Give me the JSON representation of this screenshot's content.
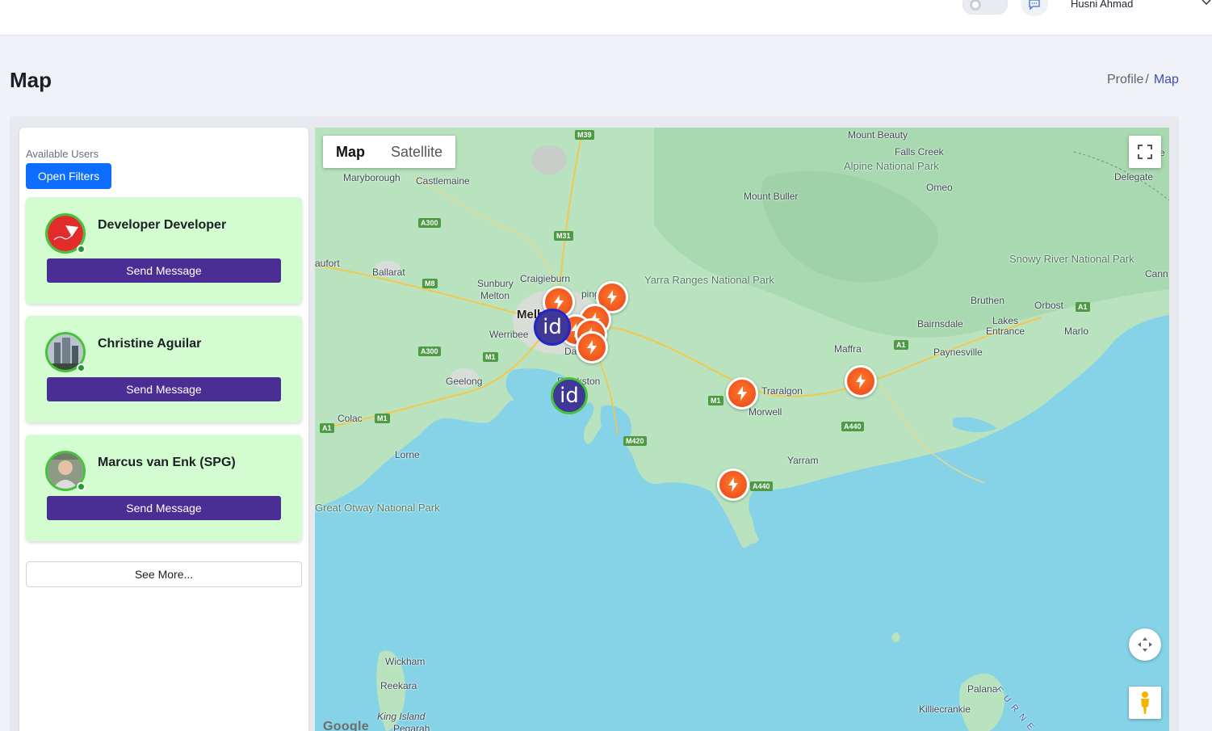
{
  "topbar": {
    "username": "Husni Ahmad",
    "icons": [
      "toggle-switch",
      "chat-icon",
      "chevron-down-icon"
    ]
  },
  "page": {
    "title": "Map",
    "breadcrumb": {
      "parent": "Profile",
      "separator": "/",
      "current": "Map"
    }
  },
  "users_panel": {
    "label": "Available Users",
    "filters_button": "Open Filters",
    "users": [
      {
        "name": "Developer Developer",
        "action": "Send Message",
        "status": "online"
      },
      {
        "name": "Christine Aguilar",
        "action": "Send Message",
        "status": "online"
      },
      {
        "name": "Marcus van Enk (SPG)",
        "action": "Send Message",
        "status": "online"
      }
    ],
    "see_more": "See More..."
  },
  "map": {
    "type_buttons": {
      "map": "Map",
      "satellite": "Satellite",
      "selected": "Map"
    },
    "labels": {
      "maryborough": "Maryborough",
      "castlemaine": "Castlemaine",
      "ballarat": "Ballarat",
      "sunbury": "Sunbury",
      "craigieburn": "Craigieburn",
      "melton": "Melton",
      "werribee": "Werribee",
      "geelong": "Geelong",
      "colac": "Colac",
      "lorne": "Lorne",
      "melbourne": "Melb",
      "frankston": "Frankston",
      "epping": "ping",
      "dandenong": "Da",
      "traralgon": "Traralgon",
      "morwell": "Morwell",
      "maffra": "Maffra",
      "yarram": "Yarram",
      "bairnsdale": "Bairnsdale",
      "bruthen": "Bruthen",
      "lakes_entrance": "Lakes Entrance",
      "paynesville": "Paynesville",
      "orbost": "Orbost",
      "marlo": "Marlo",
      "omeo": "Omeo",
      "mount_buller": "Mount Buller",
      "mount_beauty": "Mount Beauty",
      "falls_creek": "Falls Creek",
      "delegate": "Delegate",
      "cann": "Cann",
      "aufort": "aufort",
      "be": "Be",
      "wickham": "Wickham",
      "reekara": "Reekara",
      "king_island": "King Island",
      "pegarah": "Pegarah",
      "palana": "Palana",
      "killiecrankie": "Killiecrankie",
      "furneaux": "F U R N E A"
    },
    "parks": {
      "yarra": "Yarra Ranges National Park",
      "alpine": "Alpine National Park",
      "snowy": "Snowy River National Park",
      "otway": "Great Otway National Park"
    },
    "roads": [
      "M39",
      "A300",
      "M31",
      "M8",
      "A300",
      "M1",
      "M1",
      "A1",
      "M420",
      "M1",
      "A1",
      "A1",
      "A440",
      "A440"
    ],
    "attribution": "Google",
    "controls": [
      "fullscreen-icon",
      "camera-control-icon",
      "pegman-icon"
    ],
    "markers": {
      "charger_count": 9,
      "user_markers": 2,
      "user_marker_text": "id"
    }
  },
  "colors": {
    "primary_button": "#0d6efd",
    "send_button": "#4a2e93",
    "user_card_bg": "#d3fdd0",
    "online": "#1a9e2c",
    "marker": "#e8431a",
    "water": "#86d3e8",
    "land": "#b8e3be"
  }
}
